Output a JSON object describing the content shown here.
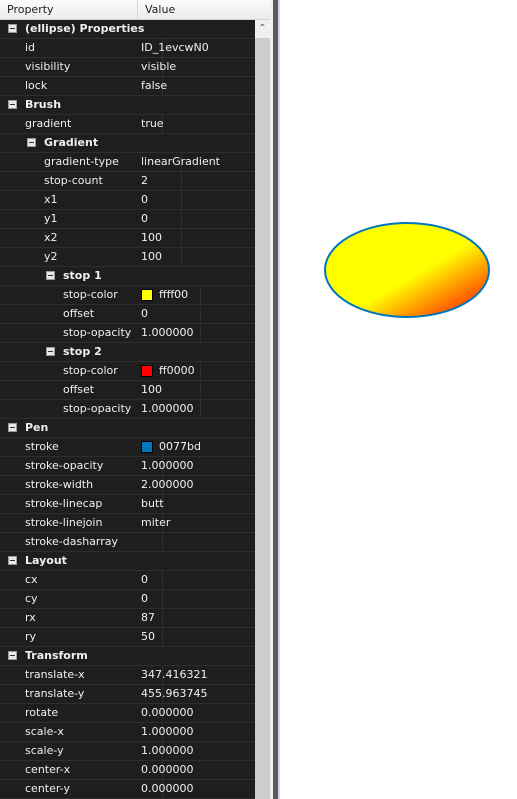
{
  "header": {
    "property": "Property",
    "value": "Value"
  },
  "rows": [
    {
      "level": 0,
      "group": true,
      "name": "(ellipse) Properties"
    },
    {
      "level": 1,
      "name": "id",
      "value": "ID_1evcwN0"
    },
    {
      "level": 1,
      "name": "visibility",
      "value": "visible"
    },
    {
      "level": 1,
      "name": "lock",
      "value": "false"
    },
    {
      "level": 0,
      "group": true,
      "name": "Brush"
    },
    {
      "level": 1,
      "name": "gradient",
      "value": "true"
    },
    {
      "level": 1,
      "group": true,
      "name": "Gradient"
    },
    {
      "level": 2,
      "name": "gradient-type",
      "value": "linearGradient"
    },
    {
      "level": 2,
      "name": "stop-count",
      "value": "2"
    },
    {
      "level": 2,
      "name": "x1",
      "value": "0"
    },
    {
      "level": 2,
      "name": "y1",
      "value": "0"
    },
    {
      "level": 2,
      "name": "x2",
      "value": "100"
    },
    {
      "level": 2,
      "name": "y2",
      "value": "100"
    },
    {
      "level": 2,
      "group": true,
      "name": "stop 1"
    },
    {
      "level": 3,
      "name": "stop-color",
      "value": "ffff00",
      "swatch": "#ffff00"
    },
    {
      "level": 3,
      "name": "offset",
      "value": "0"
    },
    {
      "level": 3,
      "name": "stop-opacity",
      "value": "1.000000"
    },
    {
      "level": 2,
      "group": true,
      "name": "stop 2"
    },
    {
      "level": 3,
      "name": "stop-color",
      "value": "ff0000",
      "swatch": "#ff0000"
    },
    {
      "level": 3,
      "name": "offset",
      "value": "100"
    },
    {
      "level": 3,
      "name": "stop-opacity",
      "value": "1.000000"
    },
    {
      "level": 0,
      "group": true,
      "name": "Pen"
    },
    {
      "level": 1,
      "name": "stroke",
      "value": "0077bd",
      "swatch": "#0077bd"
    },
    {
      "level": 1,
      "name": "stroke-opacity",
      "value": "1.000000"
    },
    {
      "level": 1,
      "name": "stroke-width",
      "value": "2.000000"
    },
    {
      "level": 1,
      "name": "stroke-linecap",
      "value": "butt"
    },
    {
      "level": 1,
      "name": "stroke-linejoin",
      "value": "miter"
    },
    {
      "level": 1,
      "name": "stroke-dasharray",
      "value": ""
    },
    {
      "level": 0,
      "group": true,
      "name": "Layout"
    },
    {
      "level": 1,
      "name": "cx",
      "value": "0"
    },
    {
      "level": 1,
      "name": "cy",
      "value": "0"
    },
    {
      "level": 1,
      "name": "rx",
      "value": "87"
    },
    {
      "level": 1,
      "name": "ry",
      "value": "50"
    },
    {
      "level": 0,
      "group": true,
      "name": "Transform"
    },
    {
      "level": 1,
      "name": "translate-x",
      "value": "347.416321"
    },
    {
      "level": 1,
      "name": "translate-y",
      "value": "455.963745"
    },
    {
      "level": 1,
      "name": "rotate",
      "value": "0.000000"
    },
    {
      "level": 1,
      "name": "scale-x",
      "value": "1.000000"
    },
    {
      "level": 1,
      "name": "scale-y",
      "value": "1.000000"
    },
    {
      "level": 1,
      "name": "center-x",
      "value": "0.000000"
    },
    {
      "level": 1,
      "name": "center-y",
      "value": "0.000000"
    }
  ],
  "ellipse": {
    "fill_start": "#ffff00",
    "fill_end": "#ff0000",
    "stroke": "#0077bd"
  },
  "icons": {
    "scroll_up": "chevron-up-icon",
    "toggle": "collapse-minus-icon"
  }
}
